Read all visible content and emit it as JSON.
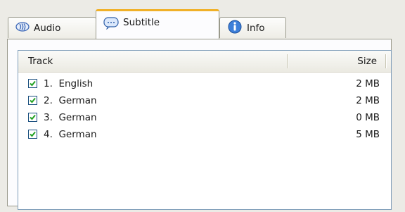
{
  "tabs": [
    {
      "label": "Audio",
      "icon": "speaker-icon",
      "selected": false
    },
    {
      "label": "Subtitle",
      "icon": "speech-bubble-icon",
      "selected": true
    },
    {
      "label": "Info",
      "icon": "info-icon",
      "selected": false
    }
  ],
  "list": {
    "columns": [
      "Track",
      "Size"
    ],
    "rows": [
      {
        "checked": true,
        "track": "1.  English",
        "size": "2 MB"
      },
      {
        "checked": true,
        "track": "2.  German",
        "size": "2 MB"
      },
      {
        "checked": true,
        "track": "3.  German",
        "size": "0 MB"
      },
      {
        "checked": true,
        "track": "4.  German",
        "size": "5 MB"
      }
    ]
  },
  "colors": {
    "checkmark": "#21a121",
    "selected_tab_accent": "#f0b028",
    "list_border": "#7f9db9"
  }
}
